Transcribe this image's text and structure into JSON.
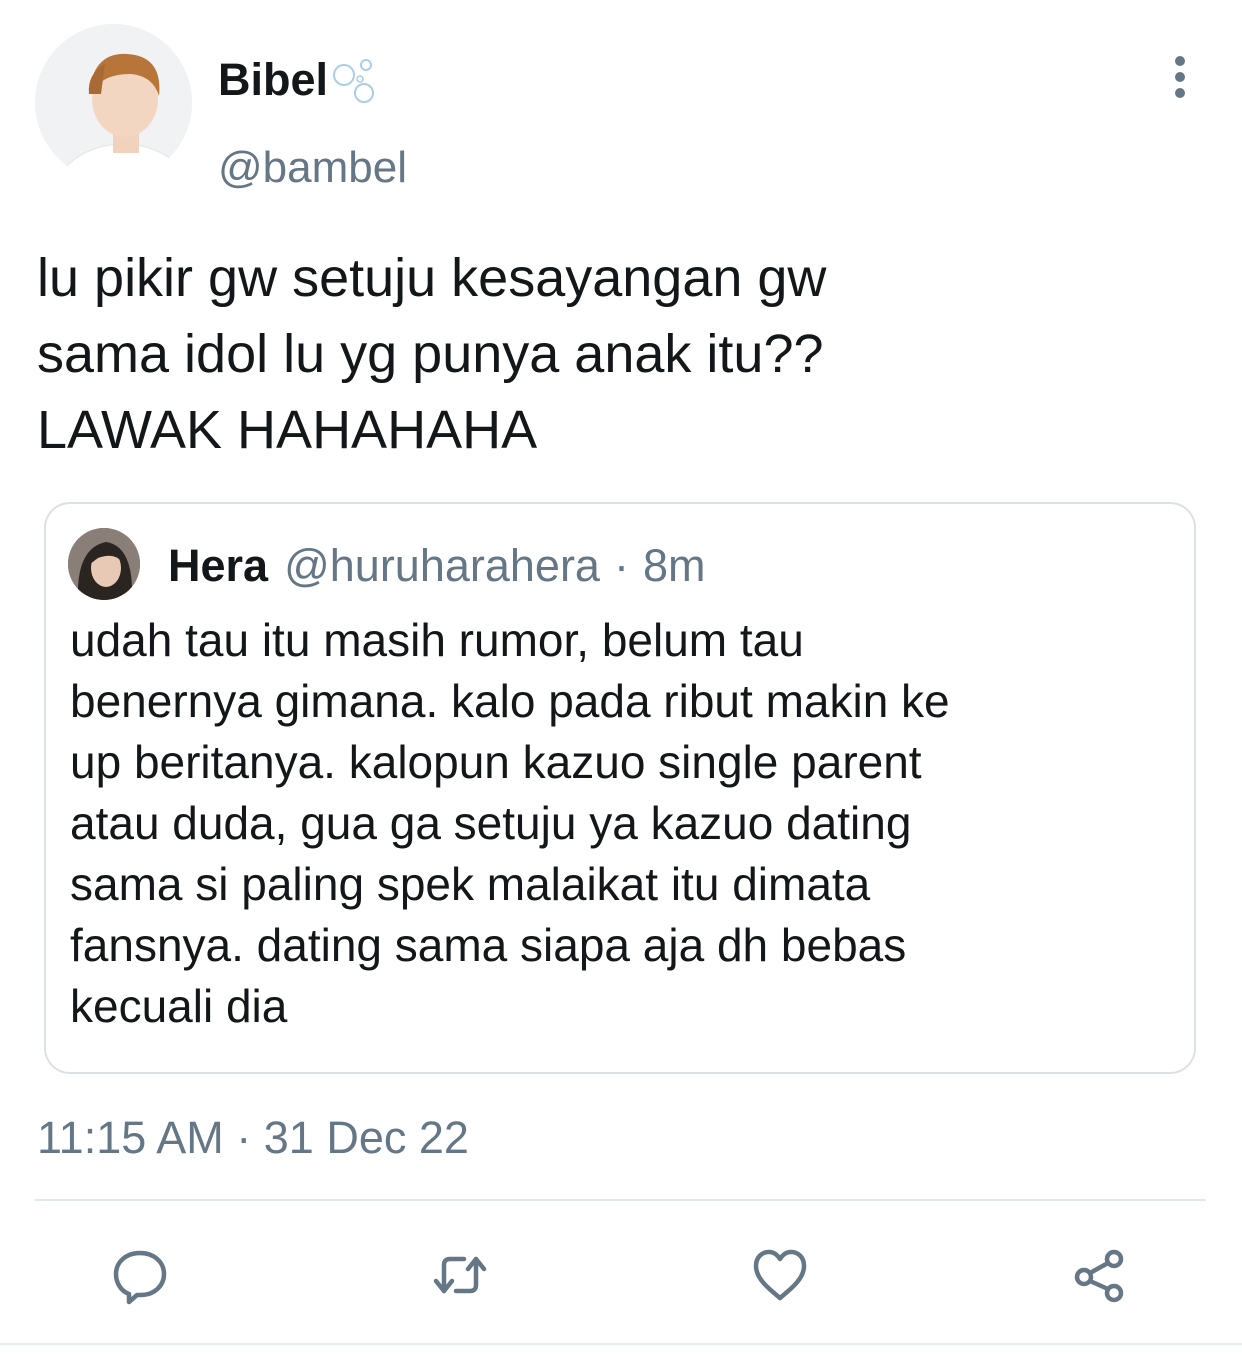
{
  "author": {
    "display_name": "Bibel",
    "handle": "@bambel"
  },
  "tweet": {
    "text": "lu pikir gw setuju kesayangan gw\nsama idol lu yg punya anak itu??\nLAWAK HAHAHAHA",
    "timestamp": "11:15 AM · 31 Dec 22"
  },
  "quoted_tweet": {
    "display_name": "Hera",
    "handle": "@huruharahera",
    "separator": "·",
    "time": "8m",
    "text": "udah tau itu masih rumor, belum tau\nbenernya gimana. kalo pada ribut makin ke\nup beritanya. kalopun kazuo single parent\natau duda, gua ga setuju ya kazuo dating\nsama si paling spek malaikat itu dimata\nfansnya. dating sama siapa aja dh bebas\nkecuali dia"
  },
  "actions": [
    {
      "icon": "reply-icon"
    },
    {
      "icon": "retweet-icon"
    },
    {
      "icon": "like-icon"
    },
    {
      "icon": "share-icon"
    }
  ],
  "colors": {
    "text_primary": "#14171a",
    "text_secondary": "#657786",
    "icon": "#657786",
    "border": "#dbe1e6"
  }
}
